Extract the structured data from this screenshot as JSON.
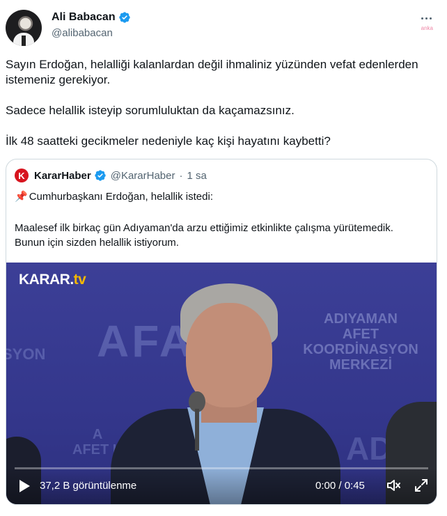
{
  "author": {
    "name": "Ali Babacan",
    "handle": "@alibabacan"
  },
  "watermark": "anka",
  "tweet": {
    "paragraph1": "Sayın Erdoğan, helalliği kalanlardan değil ihmaliniz yüzünden vefat edenlerden istemeniz gerekiyor.",
    "paragraph2": "Sadece helallik isteyip sorumluluktan da kaçamazsınız.",
    "paragraph3": "İlk 48 saatteki gecikmeler nedeniyle kaç kişi hayatını kaybetti?"
  },
  "quote": {
    "logo_letter": "K",
    "name": "KararHaber",
    "handle": "@KararHaber",
    "separator": "·",
    "time": "1 sa",
    "line1": "Cumhurbaşkanı Erdoğan, helallik istedi:",
    "body": "Maalesef ilk birkaç gün Adıyaman'da arzu ettiğimiz etkinlikte çalışma yürütemedik. Bunun için sizden helallik istiyorum."
  },
  "video": {
    "channel_logo": "KARAR.",
    "channel_logo_suffix": "tv",
    "bg_text_main": "AFAD",
    "bg_text_left": "I\nSYON",
    "bg_text_right": "ADIYAMAN\nAFET KOORDİNASYON\nMERKEZİ",
    "bg_text_low": "A\nAFET K",
    "bg_text_lowright": "AD",
    "views": "37,2 B görüntülenme",
    "time": "0:00 / 0:45",
    "progress": 0
  },
  "colors": {
    "verified": "#1d9bf0",
    "karar_red": "#d7141e",
    "video_bg": "#3a3d94"
  }
}
